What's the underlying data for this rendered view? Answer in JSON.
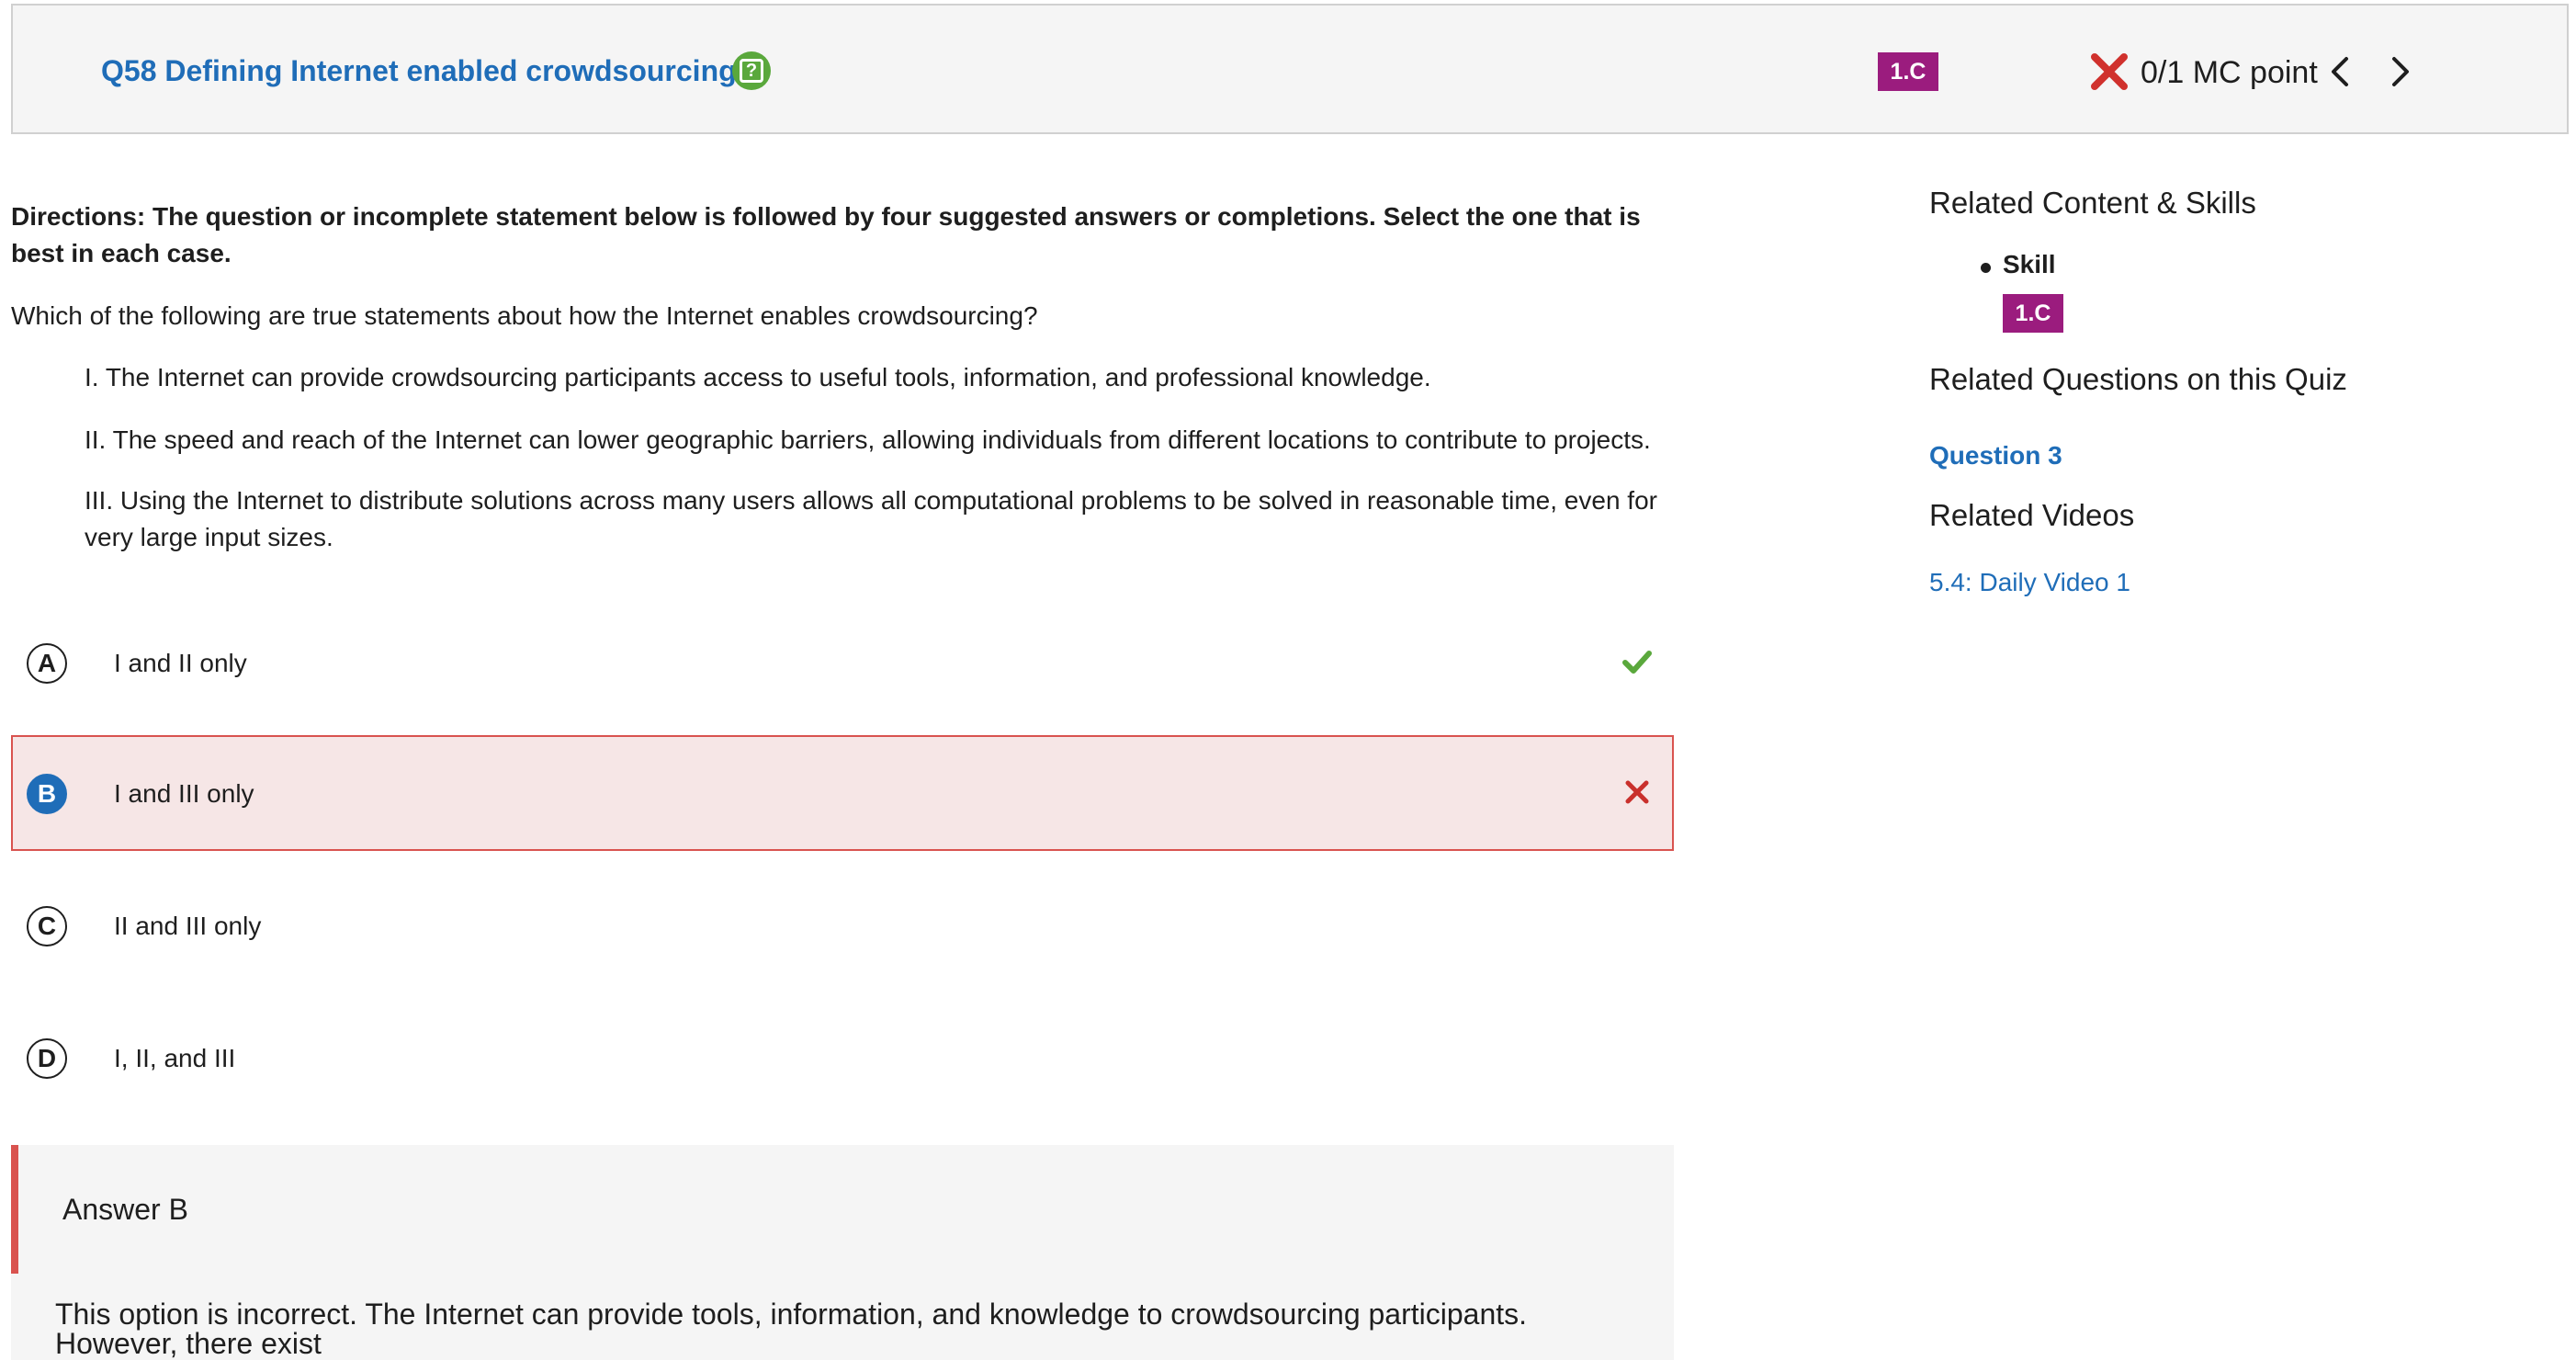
{
  "header": {
    "title": "Q58 Defining Internet enabled crowdsourcing",
    "skill_badge": "1.C",
    "score": "0/1 MC point"
  },
  "question": {
    "directions": "Directions: The question or incomplete statement below is followed by four suggested answers or completions. Select the one that is best in each case.",
    "stem": "Which of the following are true statements about how the Internet enables crowdsourcing?",
    "statements": [
      "I. The Internet can provide crowdsourcing participants access to useful tools, information, and professional knowledge.",
      "II. The speed and reach of the Internet can lower geographic barriers, allowing individuals from different locations to contribute to projects.",
      "III. Using the Internet to distribute solutions across many users allows all computational problems to be solved in reasonable time, even for very large input sizes."
    ],
    "options": [
      {
        "letter": "A",
        "text": "I and II only"
      },
      {
        "letter": "B",
        "text": "I and III only"
      },
      {
        "letter": "C",
        "text": "II and III only"
      },
      {
        "letter": "D",
        "text": "I, II, and III"
      }
    ]
  },
  "explanation": {
    "title": "Answer B",
    "text": "This option is incorrect. The Internet can provide tools, information, and knowledge to crowdsourcing participants. However, there exist"
  },
  "sidebar": {
    "related_heading": "Related Content & Skills",
    "skill_label": "Skill",
    "skill_badge": "1.C",
    "quiz_heading": "Related Questions on this Quiz",
    "quiz_link": "Question 3",
    "videos_heading": "Related Videos",
    "video_link": "5.4: Daily Video 1"
  },
  "colors": {
    "link_blue": "#1f6db8",
    "badge_purple": "#9b1c7e",
    "correct_green": "#5aa83c",
    "incorrect_red": "#d9534f"
  }
}
